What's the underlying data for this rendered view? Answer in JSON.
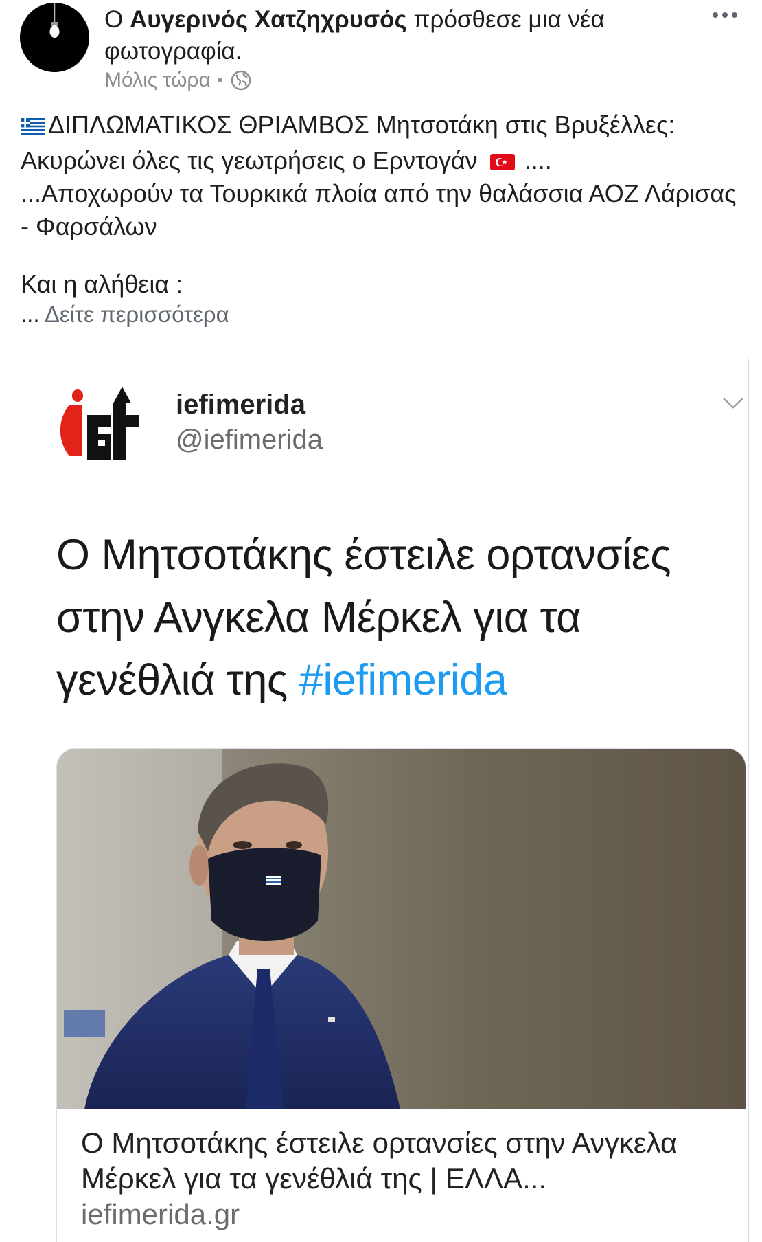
{
  "post": {
    "author_prefix": "Ο ",
    "author_name": "Αυγερινός Χατζηχρυσός",
    "action": " πρόσθεσε μια νέα φωτογραφία.",
    "time": "Μόλις τώρα",
    "text_line1": "ΔΙΠΛΩΜΑΤΙΚΟΣ ΘΡΙΑΜΒΟΣ Μητσοτάκη στις Βρυξέλλες:",
    "text_line2": "Ακυρώνει όλες τις γεωτρήσεις ο Ερντογάν",
    "text_line2_tail": " ....",
    "text_line3": "...Αποχωρούν τα Τουρκικά πλοία από την θαλάσσια ΑΟΖ Λάρισας - Φαρσάλων",
    "text_line4": "Και η αλήθεια :",
    "ellipsis": "... ",
    "see_more": "Δείτε περισσότερα"
  },
  "tweet": {
    "display_name": "iefimerida",
    "handle": "@iefimerida",
    "text": "Ο Μητσοτάκης έστειλε ορτανσίες στην Ανγκελα Μέρκελ για τα γενέθλιά της ",
    "hashtag": "#iefimerida",
    "link_title": "Ο Μητσοτάκης έστειλε ορτανσίες στην Ανγκελα Μέρκελ για τα γενέθλιά της | ΕΛΛΑ...",
    "link_domain": "iefimerida.gr"
  },
  "colors": {
    "hashtag": "#1d9bf0",
    "meta_text": "#8a8d91",
    "see_more": "#606770"
  }
}
